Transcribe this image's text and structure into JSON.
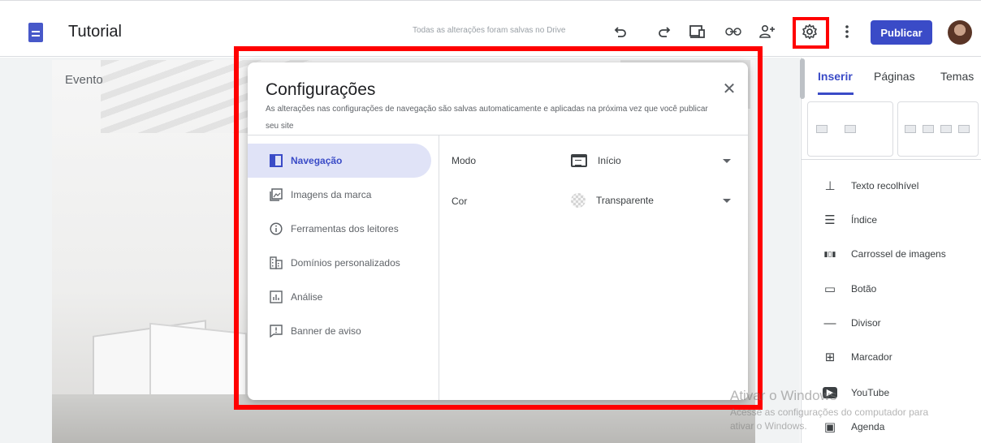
{
  "header": {
    "title": "Tutorial",
    "saved_status": "Todas as alterações foram salvas no Drive",
    "publish_label": "Publicar",
    "icons": [
      "undo-icon",
      "redo-icon",
      "preview-icon",
      "link-icon",
      "share-icon",
      "gear-icon",
      "more-vert-icon"
    ]
  },
  "page": {
    "section_text": "Evento"
  },
  "modal": {
    "title": "Configurações",
    "subtitle": "As alterações nas configurações de navegação são salvas automaticamente e aplicadas na próxima vez que você publicar seu site",
    "close_glyph": "✕",
    "nav_items": [
      {
        "label": "Navegação",
        "icon": "navigation-icon",
        "active": true
      },
      {
        "label": "Imagens da marca",
        "icon": "brand-images-icon",
        "active": false
      },
      {
        "label": "Ferramentas dos leitores",
        "icon": "info-icon",
        "active": false
      },
      {
        "label": "Domínios personalizados",
        "icon": "domain-icon",
        "active": false
      },
      {
        "label": "Análise",
        "icon": "analytics-icon",
        "active": false
      },
      {
        "label": "Banner de aviso",
        "icon": "banner-icon",
        "active": false
      }
    ],
    "settings": [
      {
        "label": "Modo",
        "value": "Início",
        "icon": "top-nav-icon"
      },
      {
        "label": "Cor",
        "value": "Transparente",
        "icon": "transparent-icon"
      }
    ]
  },
  "sidebar": {
    "tabs": [
      {
        "label": "Inserir",
        "active": true
      },
      {
        "label": "Páginas",
        "active": false
      },
      {
        "label": "Temas",
        "active": false
      }
    ],
    "items": [
      {
        "label": "Texto recolhível",
        "icon": "collapsible-text-icon",
        "glyph": "⊥"
      },
      {
        "label": "Índice",
        "icon": "toc-icon",
        "glyph": "☰"
      },
      {
        "label": "Carrossel de imagens",
        "icon": "carousel-icon",
        "glyph": "▮▯▮"
      },
      {
        "label": "Botão",
        "icon": "button-icon",
        "glyph": "▭"
      },
      {
        "label": "Divisor",
        "icon": "divider-icon",
        "glyph": "—"
      },
      {
        "label": "Marcador",
        "icon": "placeholder-icon",
        "glyph": "⊞"
      },
      {
        "label": "YouTube",
        "icon": "youtube-icon",
        "glyph": "▶"
      },
      {
        "label": "Agenda",
        "icon": "calendar-icon",
        "glyph": "▣"
      }
    ]
  },
  "watermark": {
    "title": "Ativar o Windows",
    "line1": "Acesse as configurações do computador para",
    "line2": "ativar o Windows."
  },
  "colors": {
    "accent": "#3a4bc7",
    "highlight": "#ff0000",
    "active_nav_bg": "#e0e3f7"
  }
}
